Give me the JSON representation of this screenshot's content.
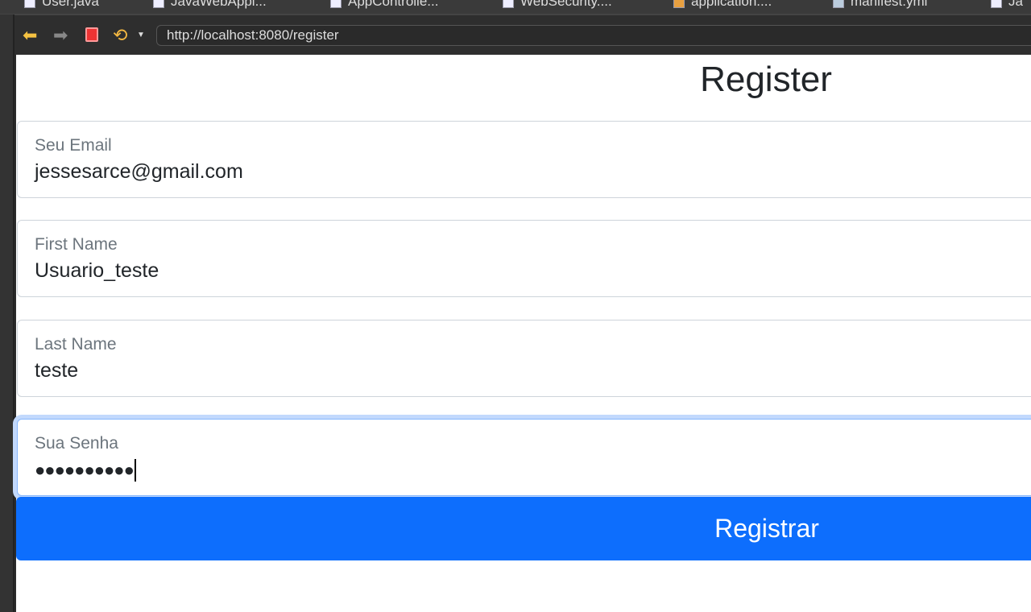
{
  "editor_tabs": [
    "User.java",
    "JavaWebAppl...",
    "AppControlle...",
    "WebSecurity....",
    "application....",
    "manifest.yml",
    "Ja"
  ],
  "browser": {
    "url": "http://localhost:8080/register",
    "back_icon": "arrow-left",
    "forward_icon": "arrow-right",
    "stop_icon": "stop-square",
    "refresh_icon": "refresh-arrows"
  },
  "page": {
    "title": "Register",
    "fields": [
      {
        "label": "Seu Email",
        "value": "jessesarce@gmail.com"
      },
      {
        "label": "First Name",
        "value": "Usuario_teste"
      },
      {
        "label": "Last Name",
        "value": "teste"
      },
      {
        "label": "Sua Senha",
        "value": "●●●●●●●●●●"
      }
    ],
    "submit_label": "Registrar"
  },
  "colors": {
    "primary": "#0d6efd",
    "focus_ring": "#c2d9fd"
  }
}
